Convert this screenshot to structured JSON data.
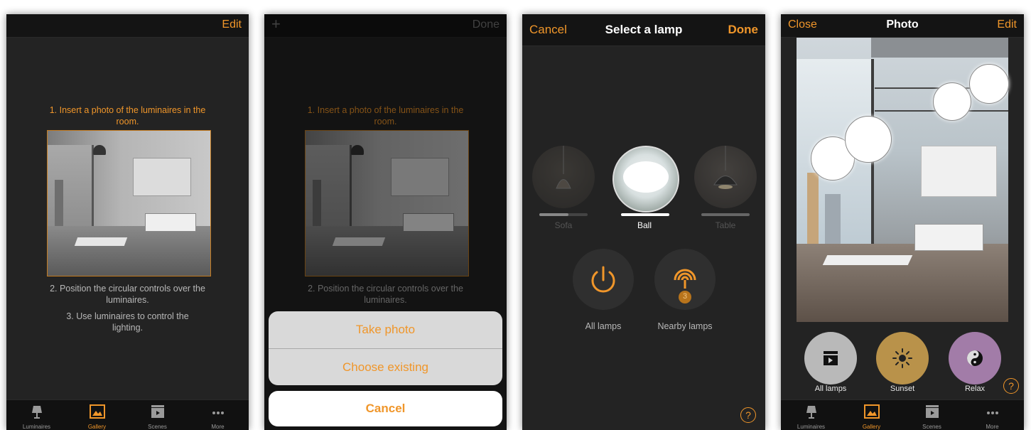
{
  "screen1": {
    "nav": {
      "edit": "Edit"
    },
    "steps": [
      "1. Insert a photo of the luminaires in the room.",
      "2. Position the circular controls over the luminaires.",
      "3. Use luminaires to control the lighting."
    ]
  },
  "screen2": {
    "nav": {
      "add": "+",
      "done": "Done"
    },
    "steps": [
      "1. Insert a photo of the luminaires in the room.",
      "2. Position the circular controls over the luminaires."
    ],
    "sheet": {
      "take_photo": "Take photo",
      "choose_existing": "Choose existing",
      "cancel": "Cancel"
    }
  },
  "screen3": {
    "nav": {
      "cancel": "Cancel",
      "title": "Select a lamp",
      "done": "Done"
    },
    "lamps": [
      {
        "label": "Sofa",
        "level": 0.6
      },
      {
        "label": "Ball",
        "level": 1.0
      },
      {
        "label": "Table",
        "level": 1.0
      }
    ],
    "buttons": {
      "all_lamps": "All lamps",
      "nearby_lamps": "Nearby lamps",
      "nearby_count": "3"
    },
    "help": "?"
  },
  "screen4": {
    "nav": {
      "close": "Close",
      "title": "Photo",
      "edit": "Edit"
    },
    "scenes": [
      {
        "label": "All lamps",
        "color": "#b9b9b9"
      },
      {
        "label": "Sunset",
        "color": "#b9924a"
      },
      {
        "label": "Relax",
        "color": "#a27ca8"
      }
    ],
    "help": "?"
  },
  "tabbar": {
    "items": [
      {
        "label": "Luminaires",
        "icon": "lamp-icon"
      },
      {
        "label": "Gallery",
        "icon": "gallery-icon"
      },
      {
        "label": "Scenes",
        "icon": "clapperboard-icon"
      },
      {
        "label": "More",
        "icon": "more-dots-icon"
      }
    ]
  },
  "colors": {
    "accent": "#f0962a",
    "background": "#232323",
    "bar": "#141414"
  }
}
